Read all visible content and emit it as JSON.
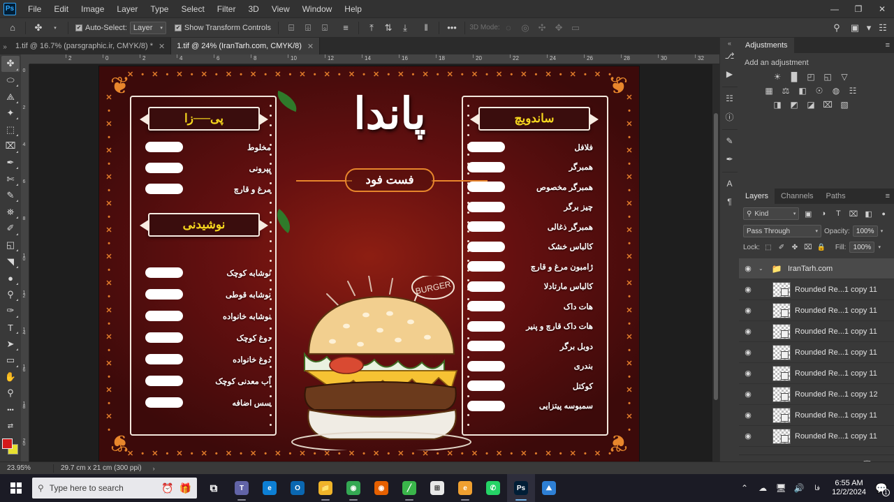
{
  "app": {
    "name": "Photoshop",
    "logo_text": "Ps"
  },
  "menubar": {
    "items": [
      "File",
      "Edit",
      "Image",
      "Layer",
      "Type",
      "Select",
      "Filter",
      "3D",
      "View",
      "Window",
      "Help"
    ],
    "window_controls": {
      "minimize": "—",
      "maximize": "❐",
      "close": "✕"
    }
  },
  "options_bar": {
    "home_icon": "⌂",
    "move_tool_icon": "✤",
    "auto_select_label": "Auto-Select:",
    "auto_select_checked": true,
    "layer_select_value": "Layer",
    "show_transform_label": "Show Transform Controls",
    "show_transform_checked": true,
    "align_icons": [
      "⌸",
      "⌹",
      "⌺"
    ],
    "distribute_icon": "≡",
    "valign_icons": [
      "⤒",
      "⇅",
      "⤓"
    ],
    "vdist_icon": "‖",
    "more_icon": "•••",
    "mode_3d_label": "3D Mode:",
    "mode_3d_icons": [
      "◌",
      "◎",
      "✣",
      "✥",
      "▭"
    ],
    "search_icon": "⚲",
    "arrange_icon": "▣",
    "workspace_caret": "▾",
    "grid_icon": "☷"
  },
  "tabs": {
    "scroll_icon": "»",
    "items": [
      {
        "label": "1.tif @ 16.7% (parsgraphic.ir, CMYK/8) *",
        "active": false,
        "close": "✕"
      },
      {
        "label": "1.tif @ 24% (IranTarh.com, CMYK/8)",
        "active": true,
        "close": "✕"
      }
    ]
  },
  "toolbar": {
    "tools": [
      {
        "name": "move-tool",
        "glyph": "✤",
        "selected": true
      },
      {
        "name": "marquee-tool",
        "glyph": "⬭",
        "selected": false
      },
      {
        "name": "lasso-tool",
        "glyph": "⟁",
        "selected": false
      },
      {
        "name": "quick-selection-tool",
        "glyph": "✦",
        "selected": false
      },
      {
        "name": "crop-tool",
        "glyph": "⬚",
        "selected": false
      },
      {
        "name": "frame-tool",
        "glyph": "⌧",
        "selected": false
      },
      {
        "name": "eyedropper-tool",
        "glyph": "✒",
        "selected": false
      },
      {
        "name": "healing-brush-tool",
        "glyph": "✄",
        "selected": false
      },
      {
        "name": "brush-tool",
        "glyph": "✎",
        "selected": false
      },
      {
        "name": "clone-stamp-tool",
        "glyph": "⛯",
        "selected": false
      },
      {
        "name": "history-brush-tool",
        "glyph": "✐",
        "selected": false
      },
      {
        "name": "eraser-tool",
        "glyph": "◱",
        "selected": false
      },
      {
        "name": "gradient-tool",
        "glyph": "◥",
        "selected": false
      },
      {
        "name": "blur-tool",
        "glyph": "●",
        "selected": false
      },
      {
        "name": "dodge-tool",
        "glyph": "⚲",
        "selected": false
      },
      {
        "name": "pen-tool",
        "glyph": "✑",
        "selected": false
      },
      {
        "name": "type-tool",
        "glyph": "T",
        "selected": false
      },
      {
        "name": "path-selection-tool",
        "glyph": "➤",
        "selected": false
      },
      {
        "name": "rectangle-tool",
        "glyph": "▭",
        "selected": false
      },
      {
        "name": "hand-tool",
        "glyph": "✋",
        "selected": false
      },
      {
        "name": "zoom-tool",
        "glyph": "⚲",
        "selected": false
      }
    ],
    "more_glyph": "•••",
    "swap_glyph": "⇄",
    "foreground_color": "#d41a1a",
    "background_color": "#e8e130"
  },
  "rulers": {
    "horizontal_ticks": [
      "2",
      "0",
      "2",
      "4",
      "6",
      "8",
      "10",
      "12",
      "14",
      "16",
      "18",
      "20",
      "22",
      "24",
      "26",
      "28",
      "30",
      "32"
    ],
    "vertical_ticks": [
      "0",
      "2",
      "4",
      "6",
      "8",
      "10",
      "12",
      "14",
      "16",
      "18",
      "20"
    ]
  },
  "poster": {
    "brand_title": "پاندا",
    "brand_subtitle": "فست فود",
    "burger_badge": "BURGER",
    "sections": [
      {
        "id": "pizza",
        "heading": "پی──زا",
        "items": [
          "مخلوط",
          "پپرونی",
          "مرغ و قارچ"
        ]
      },
      {
        "id": "drinks",
        "heading": "نوشیدنی",
        "items": [
          "نوشابه کوچک",
          "نوشابه قوطی",
          "نوشابه خانواده",
          "دوغ کوچک",
          "دوغ خانواده",
          "آب معدنی کوچک",
          "سس اضافه"
        ]
      },
      {
        "id": "sandwich",
        "heading": "ساندویچ",
        "items": [
          "فلافل",
          "همبرگر",
          "همبرگر مخصوص",
          "چیز برگر",
          "همبرگر ذغالی",
          "کالباس خشک",
          "ژامبون مرغ و قارچ",
          "کالباس مارتادلا",
          "هات داک",
          "هات داک قارچ و پنیر",
          "دوبل برگر",
          "بندری",
          "کوکتل",
          "سمبوسه پیتزایی"
        ]
      }
    ],
    "colors": {
      "background": "#6d1111",
      "accent_orange": "#e8862c",
      "heading_yellow": "#f5d61e",
      "cream": "#f7ece2"
    }
  },
  "icon_strip": {
    "collapse_icon": "«",
    "icons": [
      {
        "name": "libraries-icon",
        "glyph": "⎇"
      },
      {
        "name": "actions-icon",
        "glyph": "▶"
      },
      {
        "name": "histogram-icon",
        "glyph": "☷"
      },
      {
        "name": "info-icon",
        "glyph": "ⓘ"
      },
      {
        "name": "brush-settings-icon",
        "glyph": "✎"
      },
      {
        "name": "brush-presets-icon",
        "glyph": "✒"
      },
      {
        "name": "character-icon",
        "glyph": "A"
      },
      {
        "name": "paragraph-icon",
        "glyph": "¶"
      }
    ]
  },
  "adjustments_panel": {
    "tab_label": "Adjustments",
    "menu_icon": "≡",
    "hint": "Add an adjustment",
    "row1": [
      {
        "name": "brightness-contrast-icon",
        "glyph": "☀"
      },
      {
        "name": "levels-icon",
        "glyph": "█"
      },
      {
        "name": "curves-icon",
        "glyph": "◰"
      },
      {
        "name": "exposure-icon",
        "glyph": "◱"
      },
      {
        "name": "vibrance-icon",
        "glyph": "▽"
      }
    ],
    "row2": [
      {
        "name": "hue-saturation-icon",
        "glyph": "▦"
      },
      {
        "name": "color-balance-icon",
        "glyph": "⚖"
      },
      {
        "name": "black-white-icon",
        "glyph": "◧"
      },
      {
        "name": "photo-filter-icon",
        "glyph": "☉"
      },
      {
        "name": "channel-mixer-icon",
        "glyph": "◍"
      },
      {
        "name": "color-lookup-icon",
        "glyph": "☷"
      }
    ],
    "row3": [
      {
        "name": "invert-icon",
        "glyph": "◨"
      },
      {
        "name": "posterize-icon",
        "glyph": "◩"
      },
      {
        "name": "threshold-icon",
        "glyph": "◪"
      },
      {
        "name": "selective-color-icon",
        "glyph": "⌧"
      },
      {
        "name": "gradient-map-icon",
        "glyph": "▧"
      }
    ]
  },
  "layers_panel": {
    "tabs": [
      {
        "label": "Layers",
        "active": true
      },
      {
        "label": "Channels",
        "active": false
      },
      {
        "label": "Paths",
        "active": false
      }
    ],
    "menu_icon": "≡",
    "filter": {
      "search_icon": "⚲",
      "kind_value": "Kind",
      "caret": "▾",
      "type_filters": [
        {
          "name": "filter-pixel-icon",
          "glyph": "▣"
        },
        {
          "name": "filter-adjustment-icon",
          "glyph": "◑"
        },
        {
          "name": "filter-type-icon",
          "glyph": "T"
        },
        {
          "name": "filter-shape-icon",
          "glyph": "⌧"
        },
        {
          "name": "filter-smart-object-icon",
          "glyph": "◧"
        }
      ],
      "toggle_icon": "●"
    },
    "blend_mode": "Pass Through",
    "blend_caret": "▾",
    "opacity_label": "Opacity:",
    "opacity_value": "100%",
    "opacity_caret": "▾",
    "lock_label": "Lock:",
    "lock_icons": [
      {
        "name": "lock-transparency-icon",
        "glyph": "⬚"
      },
      {
        "name": "lock-image-icon",
        "glyph": "✐"
      },
      {
        "name": "lock-position-icon",
        "glyph": "✤"
      },
      {
        "name": "lock-artboard-icon",
        "glyph": "⌧"
      },
      {
        "name": "lock-all-icon",
        "glyph": "🔒"
      }
    ],
    "fill_label": "Fill:",
    "fill_value": "100%",
    "fill_caret": "▾",
    "layers": [
      {
        "type": "group",
        "name": "IranTarh.com",
        "visible": true,
        "expand_caret": "⌄",
        "folder_icon": "📁"
      },
      {
        "type": "layer",
        "name": "Rounded Re...1 copy 11",
        "visible": true
      },
      {
        "type": "layer",
        "name": "Rounded Re...1 copy 11",
        "visible": true
      },
      {
        "type": "layer",
        "name": "Rounded Re...1 copy 11",
        "visible": true
      },
      {
        "type": "layer",
        "name": "Rounded Re...1 copy 11",
        "visible": true
      },
      {
        "type": "layer",
        "name": "Rounded Re...1 copy 11",
        "visible": true
      },
      {
        "type": "layer",
        "name": "Rounded Re...1 copy 12",
        "visible": true
      },
      {
        "type": "layer",
        "name": "Rounded Re...1 copy 11",
        "visible": true
      },
      {
        "type": "layer",
        "name": "Rounded Re...1 copy 11",
        "visible": true
      }
    ],
    "eye_icon": "◉",
    "bottom_buttons": [
      {
        "name": "link-layers-button",
        "glyph": "GO"
      },
      {
        "name": "layer-style-button",
        "glyph": "fx"
      },
      {
        "name": "layer-mask-button",
        "glyph": "▣"
      },
      {
        "name": "adjustment-layer-button",
        "glyph": "◑"
      },
      {
        "name": "new-group-button",
        "glyph": "📁"
      },
      {
        "name": "new-layer-button",
        "glyph": "⊞"
      },
      {
        "name": "delete-layer-button",
        "glyph": "🗑"
      }
    ]
  },
  "status_bar": {
    "zoom": "23.95%",
    "doc_info": "29.7 cm x 21 cm (300 ppi)",
    "arrow": "›"
  },
  "taskbar": {
    "start_name": "start-button",
    "search_icon": "⚲",
    "search_placeholder": "Type here to search",
    "search_extra_icons": [
      {
        "name": "clock-widget-icon",
        "glyph": "⏰"
      },
      {
        "name": "gift-widget-icon",
        "glyph": "🎁"
      }
    ],
    "apps": [
      {
        "name": "task-view-icon",
        "label": "⧉",
        "color": "#1b1b25",
        "text": "⧉",
        "open": false
      },
      {
        "name": "teams-icon",
        "label": "T",
        "color": "#6264a7",
        "text": "T",
        "open": true
      },
      {
        "name": "edge-icon",
        "label": "e",
        "color": "#0d7fd4",
        "text": "e",
        "open": false
      },
      {
        "name": "outlook-icon",
        "label": "O",
        "color": "#0a67b1",
        "text": "O",
        "open": false
      },
      {
        "name": "file-explorer-icon",
        "label": "📁",
        "color": "#f0b429",
        "text": "📁",
        "open": true
      },
      {
        "name": "chrome-icon",
        "label": "C",
        "color": "#34a853",
        "text": "◉",
        "open": true
      },
      {
        "name": "firefox-icon",
        "label": "F",
        "color": "#e66000",
        "text": "◉",
        "open": false
      },
      {
        "name": "notepad-icon",
        "label": "N",
        "color": "#3ab54a",
        "text": "╱",
        "open": true
      },
      {
        "name": "store-icon",
        "label": "S",
        "color": "#e8e8e8",
        "text": "⊞",
        "open": false
      },
      {
        "name": "browser-icon",
        "label": "e",
        "color": "#f0a030",
        "text": "e",
        "open": true
      },
      {
        "name": "whatsapp-icon",
        "label": "W",
        "color": "#25d366",
        "text": "✆",
        "open": false
      },
      {
        "name": "photoshop-icon",
        "label": "Ps",
        "color": "#001e36",
        "text": "Ps",
        "open": false,
        "active": true
      },
      {
        "name": "photos-icon",
        "label": "P",
        "color": "#2e7fd4",
        "text": "⛰",
        "open": false
      }
    ],
    "tray": {
      "chevron": "⌃",
      "icons": [
        {
          "name": "onedrive-icon",
          "glyph": "☁"
        },
        {
          "name": "network-icon",
          "glyph": "🖥"
        },
        {
          "name": "volume-icon",
          "glyph": "🔊"
        },
        {
          "name": "language-icon",
          "glyph": "فا"
        }
      ],
      "time": "6:55 AM",
      "date": "12/2/2024",
      "notification_icon": "💬",
      "notification_count": "1"
    }
  }
}
